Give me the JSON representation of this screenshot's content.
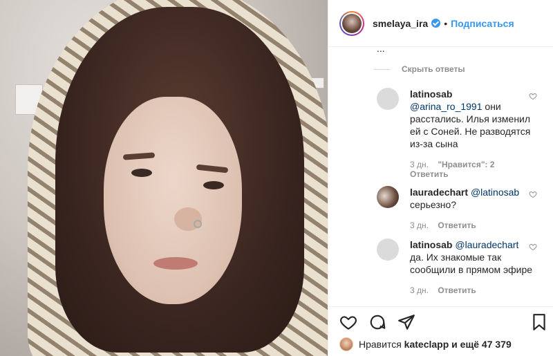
{
  "post": {
    "username": "smelaya_ira",
    "separator": "•",
    "follow_label": "Подписаться"
  },
  "comments": {
    "clipped_top": "...",
    "hide_replies_label": "Скрыть ответы",
    "items": [
      {
        "user": "latinosab",
        "mention": "@arina_ro_1991",
        "text": " они расстались. Илья изменил ей с Соней. Не разводятся из-за сына",
        "time": "3 дн.",
        "likes": "\"Нравится\": 2",
        "reply": "Ответить"
      },
      {
        "user": "lauradechart",
        "mention": "@latinosab",
        "text": " серьезно?",
        "time": "3 дн.",
        "reply": "Ответить"
      },
      {
        "user": "latinosab",
        "mention": "@lauradechart",
        "text": " да. Их знакомые так сообщили в прямом эфире",
        "time": "3 дн.",
        "reply": "Ответить"
      }
    ]
  },
  "likes_line": {
    "prefix": "Нравится",
    "user": "kateclapp",
    "suffix": "и ещё 47 379"
  },
  "colors": {
    "accent": "#3897f0",
    "muted": "#8e8e8e",
    "text": "#262626"
  },
  "icons": [
    "heart-icon",
    "comment-icon",
    "share-icon",
    "bookmark-icon",
    "verified-icon"
  ]
}
